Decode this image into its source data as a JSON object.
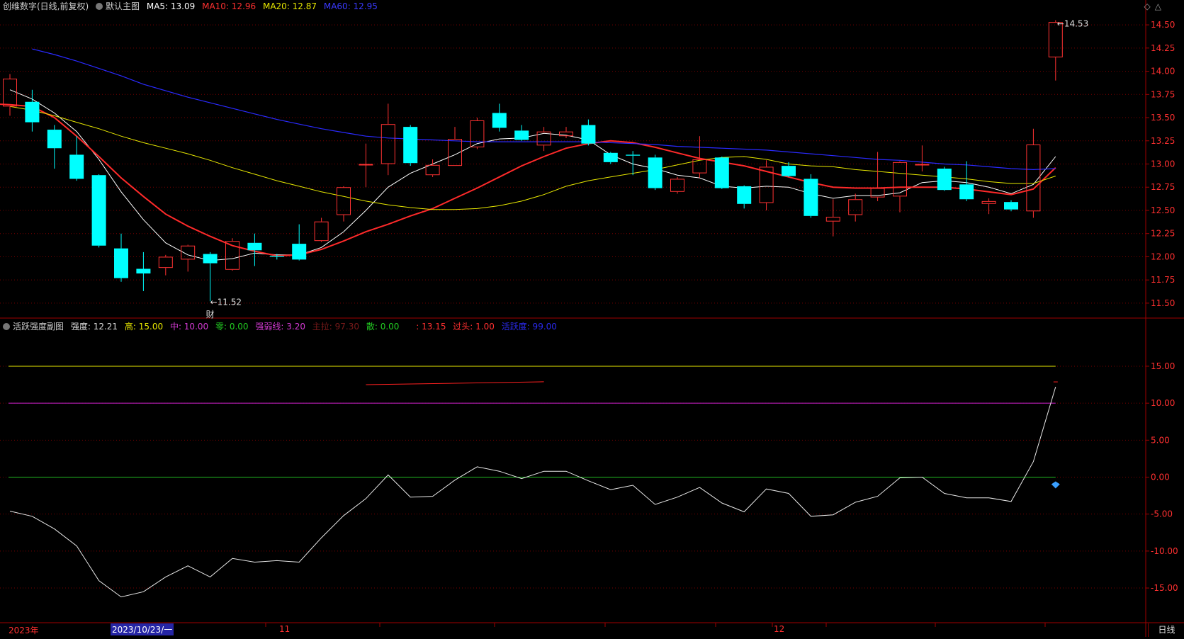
{
  "header": {
    "stock_name": "创维数字(日线,前复权)",
    "main_chart_label": "默认主图",
    "ma5": "MA5: 13.09",
    "ma10": "MA10: 12.96",
    "ma20": "MA20: 12.87",
    "ma60": "MA60: 12.95"
  },
  "sub_header": {
    "title": "活跃强度副图",
    "strength": "强度: 12.21",
    "high": "高: 15.00",
    "mid": "中: 10.00",
    "zero": "零: 0.00",
    "weak_line": "强弱线: 3.20",
    "main_pull": "主拉: 97.30",
    "retail": "散: 0.00",
    "blank": ": 13.15",
    "overhead": "过头: 1.00",
    "activity": "活跃度: 99.00"
  },
  "bottom_bar": {
    "year_label": "2023年",
    "cursor_date": "2023/10/23/一",
    "nov_label": "11",
    "dec_label": "12",
    "period_tab": "日线"
  },
  "colors": {
    "up": "#ff3232",
    "down": "#00ffff",
    "ma5": "#ffffff",
    "ma10": "#ff2a2a",
    "ma20": "#e8e800",
    "ma60": "#2a2aff",
    "grid": "#7a0000",
    "axis": "#a00000"
  },
  "chart_data": [
    {
      "type": "candlestick",
      "ylim": [
        11.4,
        14.6
      ],
      "y_ticks": [
        "11.50",
        "11.75",
        "12.00",
        "12.25",
        "12.50",
        "12.75",
        "13.00",
        "13.25",
        "13.50",
        "13.75",
        "14.00",
        "14.25",
        "14.50"
      ],
      "annotations": {
        "low_label": "11.52",
        "high_label": "14.53",
        "marker": "财"
      },
      "candles": [
        {
          "o": 13.62,
          "c": 13.92,
          "h": 13.97,
          "l": 13.52
        },
        {
          "o": 13.67,
          "c": 13.45,
          "h": 13.8,
          "l": 13.35
        },
        {
          "o": 13.37,
          "c": 13.17,
          "h": 13.42,
          "l": 12.95
        },
        {
          "o": 13.1,
          "c": 12.84,
          "h": 13.3,
          "l": 12.82
        },
        {
          "o": 12.88,
          "c": 12.12,
          "h": 12.89,
          "l": 12.1
        },
        {
          "o": 12.09,
          "c": 11.77,
          "h": 12.25,
          "l": 11.73
        },
        {
          "o": 11.87,
          "c": 11.82,
          "h": 12.05,
          "l": 11.63
        },
        {
          "o": 11.88,
          "c": 12.0,
          "h": 12.02,
          "l": 11.8
        },
        {
          "o": 11.97,
          "c": 12.12,
          "h": 12.13,
          "l": 11.84
        },
        {
          "o": 12.03,
          "c": 11.93,
          "h": 12.05,
          "l": 11.52
        },
        {
          "o": 11.86,
          "c": 12.17,
          "h": 12.2,
          "l": 11.85
        },
        {
          "o": 12.15,
          "c": 12.07,
          "h": 12.25,
          "l": 11.9
        },
        {
          "o": 12.01,
          "c": 12.0,
          "h": 12.03,
          "l": 11.97
        },
        {
          "o": 12.14,
          "c": 11.97,
          "h": 12.35,
          "l": 11.96
        },
        {
          "o": 12.17,
          "c": 12.38,
          "h": 12.42,
          "l": 12.16
        },
        {
          "o": 12.45,
          "c": 12.75,
          "h": 12.76,
          "l": 12.38
        },
        {
          "o": 13.0,
          "c": 13.0,
          "h": 13.22,
          "l": 12.75
        },
        {
          "o": 13.0,
          "c": 13.43,
          "h": 13.65,
          "l": 12.88
        },
        {
          "o": 13.4,
          "c": 13.01,
          "h": 13.42,
          "l": 12.98
        },
        {
          "o": 12.88,
          "c": 12.99,
          "h": 13.05,
          "l": 12.86
        },
        {
          "o": 12.98,
          "c": 13.27,
          "h": 13.4,
          "l": 12.98
        },
        {
          "o": 13.18,
          "c": 13.47,
          "h": 13.5,
          "l": 13.16
        },
        {
          "o": 13.55,
          "c": 13.39,
          "h": 13.65,
          "l": 13.35
        },
        {
          "o": 13.36,
          "c": 13.26,
          "h": 13.42,
          "l": 13.25
        },
        {
          "o": 13.2,
          "c": 13.35,
          "h": 13.4,
          "l": 13.14
        },
        {
          "o": 13.3,
          "c": 13.35,
          "h": 13.4,
          "l": 13.28
        },
        {
          "o": 13.42,
          "c": 13.22,
          "h": 13.48,
          "l": 13.2
        },
        {
          "o": 13.12,
          "c": 13.02,
          "h": 13.13,
          "l": 13.0
        },
        {
          "o": 13.1,
          "c": 13.09,
          "h": 13.14,
          "l": 12.88
        },
        {
          "o": 13.07,
          "c": 12.74,
          "h": 13.1,
          "l": 12.72
        },
        {
          "o": 12.7,
          "c": 12.84,
          "h": 12.86,
          "l": 12.68
        },
        {
          "o": 12.9,
          "c": 13.05,
          "h": 13.3,
          "l": 12.85
        },
        {
          "o": 13.07,
          "c": 12.74,
          "h": 13.08,
          "l": 12.73
        },
        {
          "o": 12.76,
          "c": 12.57,
          "h": 12.77,
          "l": 12.52
        },
        {
          "o": 12.58,
          "c": 12.97,
          "h": 13.04,
          "l": 12.5
        },
        {
          "o": 12.98,
          "c": 12.87,
          "h": 13.02,
          "l": 12.86
        },
        {
          "o": 12.84,
          "c": 12.44,
          "h": 12.89,
          "l": 12.42
        },
        {
          "o": 12.38,
          "c": 12.43,
          "h": 12.62,
          "l": 12.22
        },
        {
          "o": 12.45,
          "c": 12.62,
          "h": 12.68,
          "l": 12.38
        },
        {
          "o": 12.64,
          "c": 12.74,
          "h": 13.13,
          "l": 12.6
        },
        {
          "o": 12.65,
          "c": 13.02,
          "h": 13.03,
          "l": 12.48
        },
        {
          "o": 12.99,
          "c": 13.0,
          "h": 13.2,
          "l": 12.92
        },
        {
          "o": 12.95,
          "c": 12.72,
          "h": 12.97,
          "l": 12.71
        },
        {
          "o": 12.78,
          "c": 12.62,
          "h": 13.03,
          "l": 12.6
        },
        {
          "o": 12.57,
          "c": 12.6,
          "h": 12.63,
          "l": 12.46
        },
        {
          "o": 12.59,
          "c": 12.51,
          "h": 12.61,
          "l": 12.49
        },
        {
          "o": 12.49,
          "c": 13.21,
          "h": 13.38,
          "l": 12.42
        },
        {
          "o": 14.15,
          "c": 14.53,
          "h": 14.55,
          "l": 13.9
        }
      ],
      "series": [
        {
          "name": "MA5",
          "values": [
            13.8,
            13.7,
            13.55,
            13.35,
            13.05,
            12.7,
            12.4,
            12.15,
            12.02,
            11.96,
            11.98,
            12.04,
            12.02,
            12.02,
            12.1,
            12.27,
            12.5,
            12.75,
            12.9,
            13.0,
            13.1,
            13.22,
            13.27,
            13.28,
            13.33,
            13.31,
            13.26,
            13.1,
            13.0,
            12.95,
            12.88,
            12.85,
            12.76,
            12.74,
            12.76,
            12.75,
            12.68,
            12.63,
            12.66,
            12.66,
            12.69,
            12.8,
            12.82,
            12.8,
            12.75,
            12.68,
            12.78,
            13.08
          ]
        },
        {
          "name": "MA10",
          "values": [
            13.65,
            13.65,
            13.64,
            13.62,
            13.5,
            13.3,
            13.08,
            12.85,
            12.65,
            12.46,
            12.33,
            12.22,
            12.12,
            12.06,
            12.01,
            12.02,
            12.08,
            12.17,
            12.27,
            12.35,
            12.44,
            12.52,
            12.63,
            12.74,
            12.86,
            12.98,
            13.08,
            13.17,
            13.22,
            13.25,
            13.23,
            13.18,
            13.12,
            13.06,
            13.02,
            12.98,
            12.92,
            12.86,
            12.8,
            12.75,
            12.74,
            12.74,
            12.75,
            12.75,
            12.75,
            12.73,
            12.7,
            12.67,
            12.73,
            12.96
          ]
        },
        {
          "name": "MA20",
          "values": [
            13.62,
            13.58,
            13.52,
            13.45,
            13.38,
            13.3,
            13.23,
            13.17,
            13.11,
            13.04,
            12.96,
            12.89,
            12.82,
            12.76,
            12.7,
            12.65,
            12.6,
            12.56,
            12.53,
            12.51,
            12.51,
            12.52,
            12.55,
            12.6,
            12.67,
            12.76,
            12.82,
            12.86,
            12.9,
            12.94,
            12.99,
            13.04,
            13.07,
            13.08,
            13.05,
            13.0,
            12.98,
            12.97,
            12.94,
            12.92,
            12.9,
            12.88,
            12.86,
            12.84,
            12.81,
            12.79,
            12.79,
            12.87
          ]
        },
        {
          "name": "MA60",
          "values": [
            14.24,
            14.18,
            14.11,
            14.03,
            13.95,
            13.86,
            13.79,
            13.72,
            13.66,
            13.6,
            13.54,
            13.48,
            13.43,
            13.38,
            13.34,
            13.3,
            13.28,
            13.27,
            13.26,
            13.25,
            13.24,
            13.24,
            13.24,
            13.24,
            13.24,
            13.24,
            13.23,
            13.22,
            13.21,
            13.19,
            13.18,
            13.17,
            13.16,
            13.15,
            13.13,
            13.11,
            13.09,
            13.07,
            13.05,
            13.04,
            13.02,
            13.0,
            12.99,
            12.97,
            12.95,
            12.94,
            12.95
          ]
        }
      ]
    },
    {
      "type": "line",
      "ylim": [
        -19.5,
        19.5
      ],
      "y_ticks": [
        "-15.00",
        "-10.00",
        "-5.00",
        "0.00",
        "5.00",
        "10.00",
        "15.00"
      ],
      "reference_lines": [
        {
          "name": "高",
          "value": 15.0,
          "color": "#e8e800"
        },
        {
          "name": "中",
          "value": 10.0,
          "color": "#cc22cc"
        },
        {
          "name": "零",
          "value": 0.0,
          "color": "#22bb22"
        }
      ],
      "series": [
        {
          "name": "强度",
          "values": [
            -4.6,
            -5.3,
            -7.0,
            -9.3,
            -14.0,
            -16.2,
            -15.5,
            -13.5,
            -12.0,
            -13.5,
            -11.0,
            -11.5,
            -11.3,
            -11.5,
            -8.2,
            -5.2,
            -2.9,
            0.3,
            -2.7,
            -2.6,
            -0.4,
            1.4,
            0.8,
            -0.2,
            0.8,
            0.8,
            -0.5,
            -1.7,
            -1.1,
            -3.7,
            -2.7,
            -1.4,
            -3.5,
            -4.7,
            -1.6,
            -2.2,
            -5.3,
            -5.1,
            -3.4,
            -2.6,
            -0.1,
            0.0,
            -2.2,
            -2.8,
            -2.8,
            -3.3,
            2.1,
            12.21
          ]
        }
      ]
    }
  ]
}
